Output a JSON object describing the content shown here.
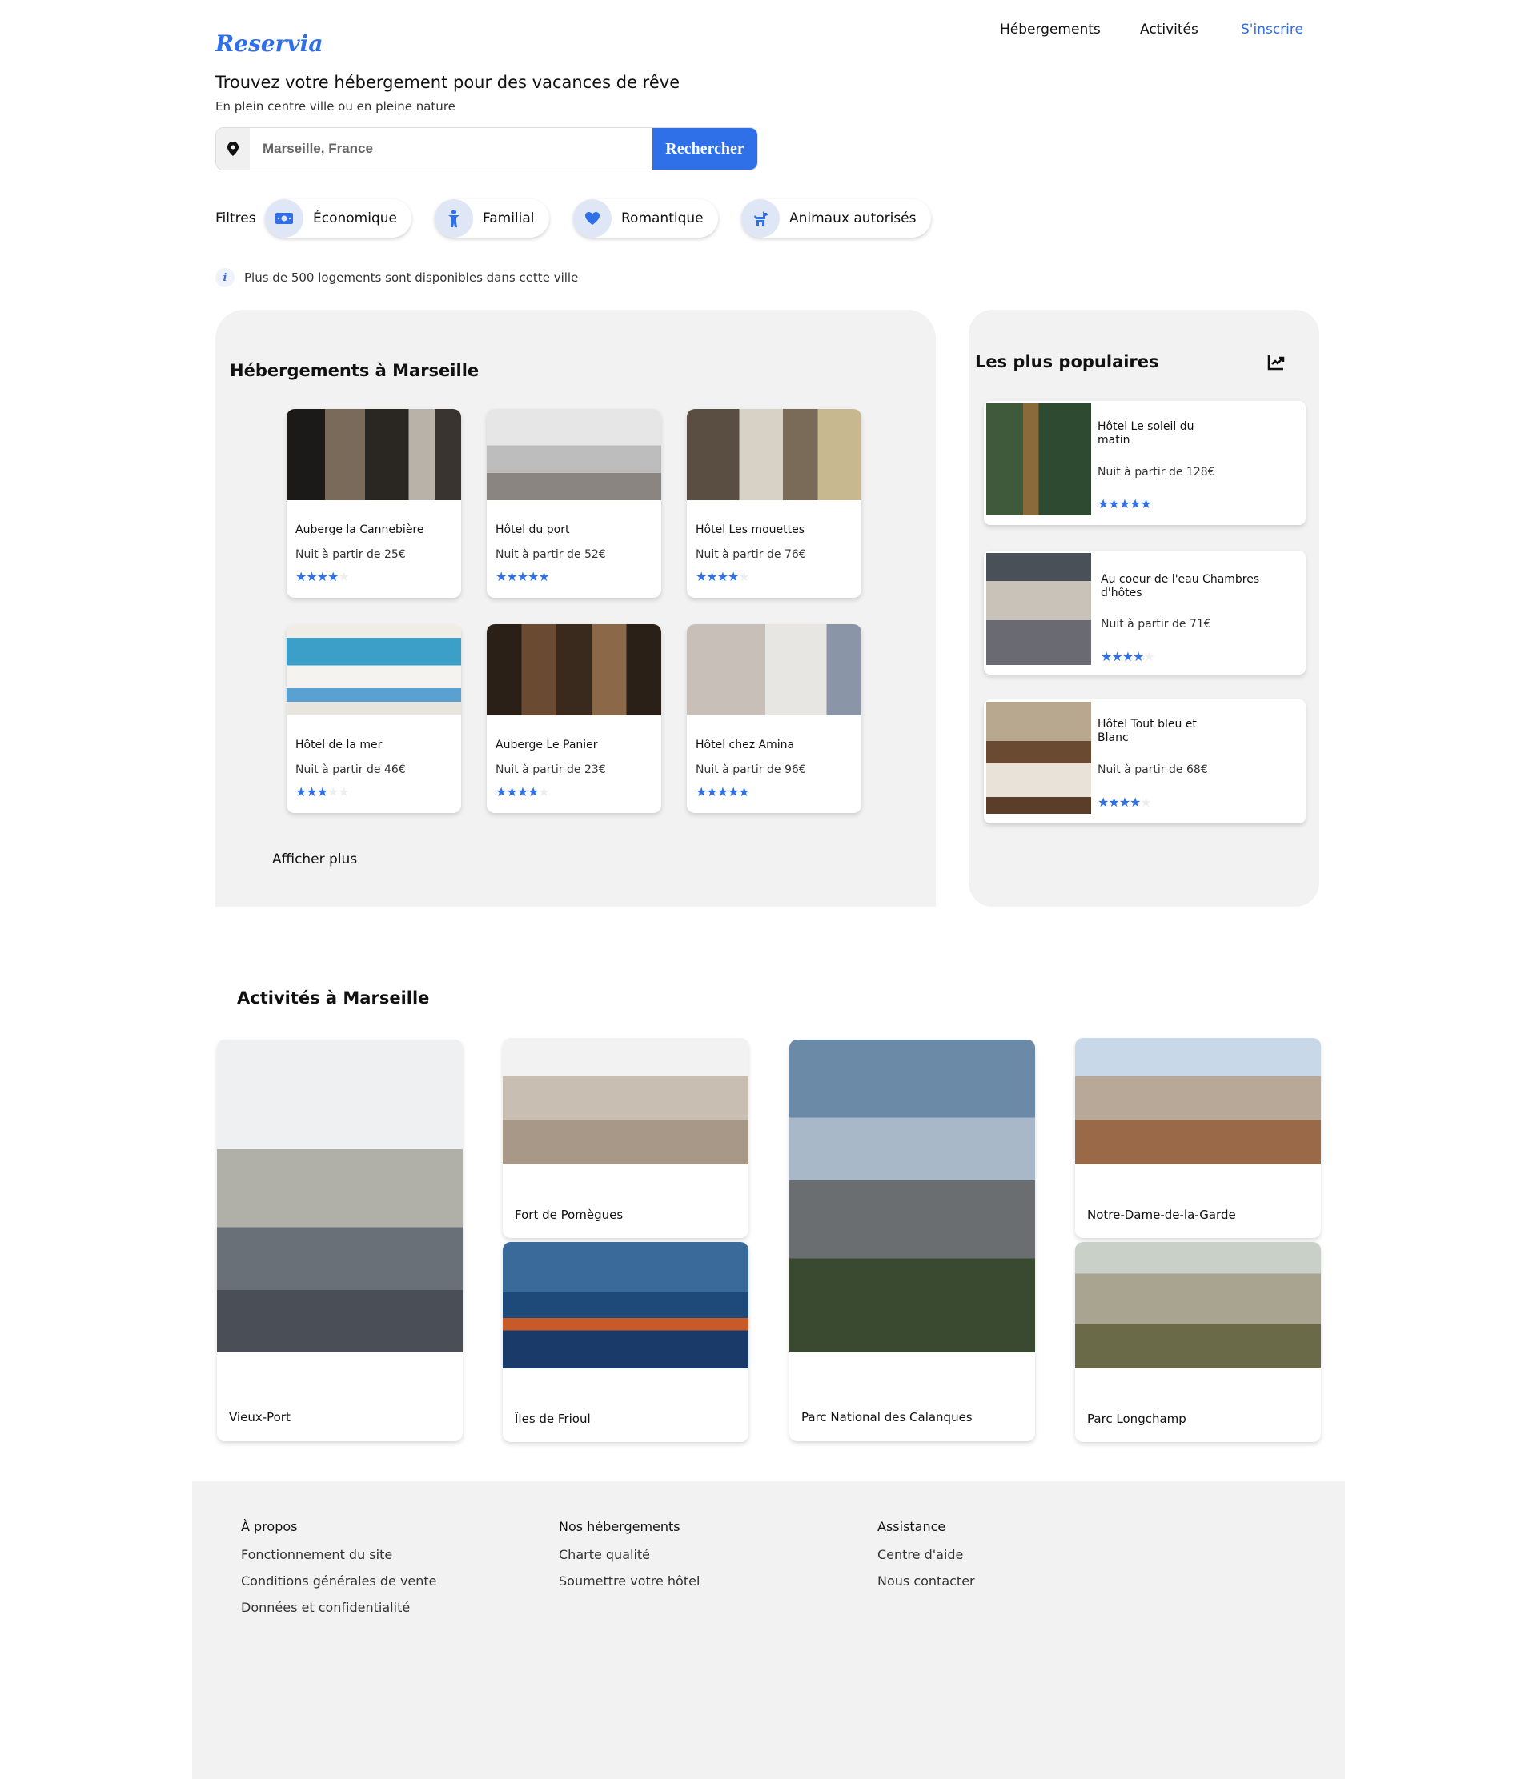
{
  "header": {
    "logo": "Reservia",
    "nav": [
      "Hébergements",
      "Activités",
      "S'inscrire"
    ],
    "title": "Trouvez votre hébergement pour des vacances de rêve",
    "subtitle": "En plein centre ville ou en pleine nature"
  },
  "search": {
    "placeholder": "Marseille, France",
    "button": "Rechercher",
    "icon": "map-pin-icon"
  },
  "filters": {
    "label": "Filtres",
    "items": [
      {
        "label": "Économique",
        "icon": "money-icon"
      },
      {
        "label": "Familial",
        "icon": "child-icon"
      },
      {
        "label": "Romantique",
        "icon": "heart-icon"
      },
      {
        "label": "Animaux autorisés",
        "icon": "dog-icon"
      }
    ]
  },
  "info": "Plus de 500 logements sont disponibles dans cette ville",
  "lodging": {
    "title": "Hébergements à Marseille",
    "cards": [
      {
        "name": "Auberge la Cannebière",
        "price": "Nuit à partir de 25€",
        "rating": 4
      },
      {
        "name": "Hôtel du port",
        "price": "Nuit à partir de 52€",
        "rating": 5
      },
      {
        "name": "Hôtel Les mouettes",
        "price": "Nuit à partir de 76€",
        "rating": 4
      },
      {
        "name": "Hôtel de la mer",
        "price": "Nuit à partir de 46€",
        "rating": 3
      },
      {
        "name": "Auberge Le Panier",
        "price": "Nuit à partir de 23€",
        "rating": 4
      },
      {
        "name": "Hôtel chez Amina",
        "price": "Nuit à partir de 96€",
        "rating": 5
      }
    ],
    "more": "Afficher plus"
  },
  "popular": {
    "title": "Les plus populaires",
    "icon": "trending-up-icon",
    "cards": [
      {
        "name": "Hôtel Le soleil du matin",
        "price": "Nuit à partir de 128€",
        "rating": 5
      },
      {
        "name": "Au coeur de l'eau Chambres d'hôtes",
        "price": "Nuit à partir de 71€",
        "rating": 4
      },
      {
        "name": "Hôtel Tout bleu et Blanc",
        "price": "Nuit à partir de 68€",
        "rating": 4
      }
    ]
  },
  "activities": {
    "title": "Activités à Marseille",
    "items": [
      "Vieux-Port",
      "Fort de Pomègues",
      "Îles de Frioul",
      "Parc National des Calanques",
      "Notre-Dame-de-la-Garde",
      "Parc Longchamp"
    ]
  },
  "footer": {
    "columns": [
      {
        "title": "À propos",
        "links": [
          "Fonctionnement du site",
          "Conditions générales de vente",
          "Données et confidentialité"
        ]
      },
      {
        "title": "Nos hébergements",
        "links": [
          "Charte qualité",
          "Soumettre votre hôtel"
        ]
      },
      {
        "title": "Assistance",
        "links": [
          "Centre d'aide",
          "Nous contacter"
        ]
      }
    ]
  },
  "colors": {
    "accent": "#2f6fe8",
    "panel": "#f2f2f2"
  }
}
